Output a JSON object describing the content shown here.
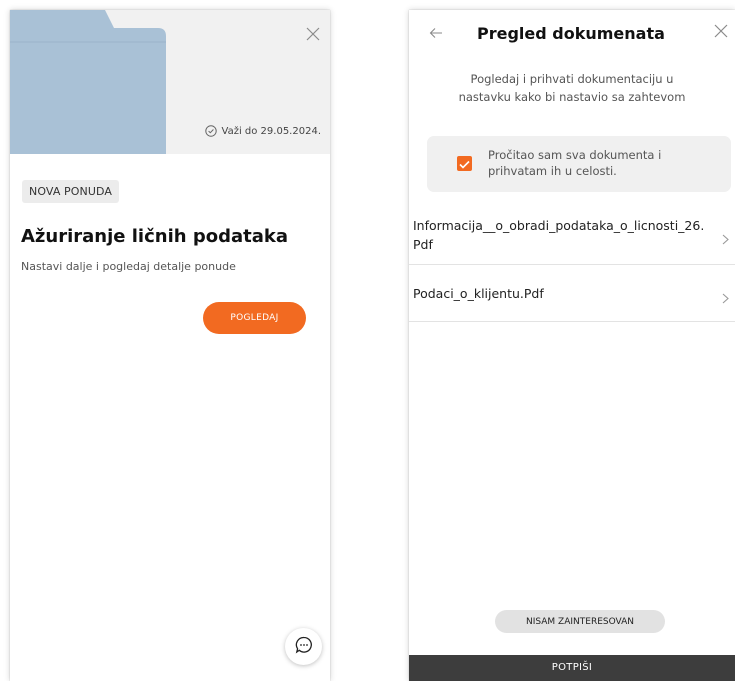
{
  "offer": {
    "valid_until": "Važi do 29.05.2024.",
    "badge": "NOVA PONUDA",
    "title": "Ažuriranje ličnih podataka",
    "subtitle": "Nastavi dalje i pogledaj detalje ponude",
    "view_button": "POGLEDAJ"
  },
  "review": {
    "title": "Pregled dokumenata",
    "instructions_line1": "Pogledaj i prihvati dokumentaciju u",
    "instructions_line2": "nastavku kako bi nastavio sa zahtevom",
    "consent_line1": "Pročitao sam sva dokumenta i",
    "consent_line2": "prihvatam ih u celosti.",
    "consent_checked": true,
    "documents": [
      {
        "name": "Informacija__o_obradi_podataka_o_licnosti_26.Pdf"
      },
      {
        "name": "Podaci_o_klijentu.Pdf"
      }
    ],
    "decline_button": "NISAM ZAINTERESOVAN",
    "sign_button": "POTPIŠI"
  },
  "colors": {
    "accent": "#f26a21",
    "folder": "#a9c1d6",
    "sign_bar": "#3d3d3d"
  },
  "icons": [
    "close-icon",
    "check-circle-icon",
    "chat-icon",
    "back-arrow-icon",
    "checkbox-check-icon",
    "chevron-right-icon"
  ]
}
